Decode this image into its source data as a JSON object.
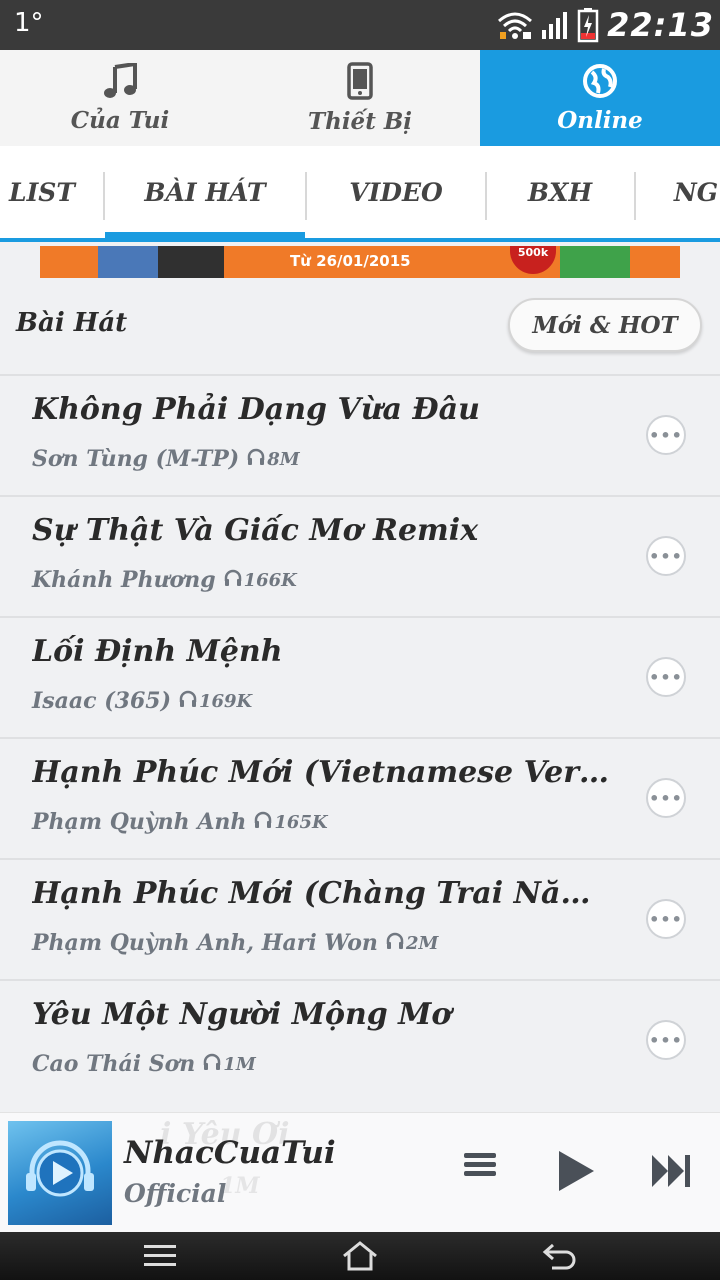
{
  "status_bar": {
    "left": "1°",
    "time": "22:13"
  },
  "main_tabs": [
    {
      "label": "Của Tui",
      "icon": "music-note-icon"
    },
    {
      "label": "Thiết Bị",
      "icon": "phone-icon"
    },
    {
      "label": "Online",
      "icon": "globe-icon",
      "active": true
    }
  ],
  "sub_tabs": [
    {
      "label": "LIST"
    },
    {
      "label": "BÀI HÁT",
      "active": true
    },
    {
      "label": "VIDEO"
    },
    {
      "label": "BXH"
    },
    {
      "label": "NG"
    }
  ],
  "banner": {
    "text": "Từ 26/01/2015",
    "seal": "500k"
  },
  "section": {
    "title": "Bài Hát",
    "filter": "Mới & HOT"
  },
  "songs": [
    {
      "title": "Không Phải Dạng Vừa Đâu",
      "artist": "Sơn Tùng (M-TP)",
      "listens": "8M"
    },
    {
      "title": "Sự Thật Và Giấc Mơ Remix",
      "artist": "Khánh Phương",
      "listens": "166K"
    },
    {
      "title": "Lối Định Mệnh",
      "artist": "Isaac (365)",
      "listens": "169K"
    },
    {
      "title": "Hạnh Phúc Mới (Vietnamese Version)",
      "artist": "Phạm Quỳnh Anh",
      "listens": "165K"
    },
    {
      "title": "Hạnh Phúc Mới (Chàng Trai Năm ...",
      "artist": "Phạm Quỳnh Anh, Hari Won",
      "listens": "2M"
    },
    {
      "title": "Yêu Một Người Mộng Mơ",
      "artist": "Cao Thái Sơn",
      "listens": "1M"
    }
  ],
  "more_label": "•••",
  "player": {
    "title": "NhacCuaTui",
    "subtitle": "Official",
    "ghost_title": "i Yêu Ơi",
    "ghost_sub": "1M"
  },
  "colors": {
    "accent": "#1a9be0",
    "text_dark": "#2a2a2a",
    "text_muted": "#707780"
  }
}
